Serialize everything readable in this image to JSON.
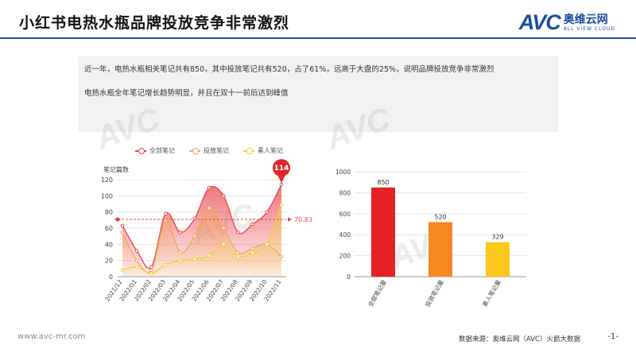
{
  "header": {
    "title": "小红书电热水瓶品牌投放竞争非常激烈",
    "logo_mark": "AVC",
    "logo_cn": "奥维云网",
    "logo_en": "ALL VIEW CLOUD"
  },
  "summary": {
    "line1": "近一年，电热水瓶相关笔记共有850，其中投放笔记共有520，占了61%，远高于大盘的25%，说明品牌投放竞争非常激烈",
    "line2": "电热水瓶全年笔记增长趋势明显，并且在双十一前后达到峰值"
  },
  "watermark": "AVC",
  "footer": {
    "site": "www.avc-mr.com",
    "source": "数据来源：奥维云网（AVC）火箭大数据",
    "page": "-1-"
  },
  "chart_data": [
    {
      "type": "area",
      "ylabel": "笔记篇数",
      "ylim": [
        0,
        120
      ],
      "yticks": [
        0,
        20,
        40,
        60,
        80,
        100,
        120
      ],
      "categories": [
        "2021/12",
        "2022/01",
        "2022/02",
        "2022/03",
        "2022/04",
        "2022/05",
        "2022/06",
        "2022/07",
        "2022/08",
        "2022/09",
        "2022/10",
        "2022/11"
      ],
      "series": [
        {
          "name": "全部笔记",
          "color": "#e8484f",
          "values": [
            63,
            32,
            12,
            78,
            55,
            72,
            110,
            100,
            55,
            65,
            80,
            114
          ]
        },
        {
          "name": "投放笔记",
          "color": "#f2a65a",
          "values": [
            55,
            20,
            8,
            70,
            30,
            50,
            85,
            60,
            30,
            35,
            40,
            25
          ]
        },
        {
          "name": "素人笔记",
          "color": "#f7cd3b",
          "values": [
            8,
            12,
            4,
            15,
            20,
            22,
            26,
            40,
            25,
            30,
            40,
            89
          ]
        }
      ],
      "average": 70.83,
      "peak_label": "114",
      "legend": "top"
    },
    {
      "type": "bar",
      "ylim": [
        0,
        1000
      ],
      "yticks": [
        0,
        200,
        400,
        600,
        800,
        1000
      ],
      "categories": [
        "全部笔记量",
        "投放笔记量",
        "素人笔记量"
      ],
      "values": [
        850,
        520,
        329
      ],
      "colors": [
        "#e52027",
        "#f7881f",
        "#fbc81b"
      ]
    }
  ]
}
